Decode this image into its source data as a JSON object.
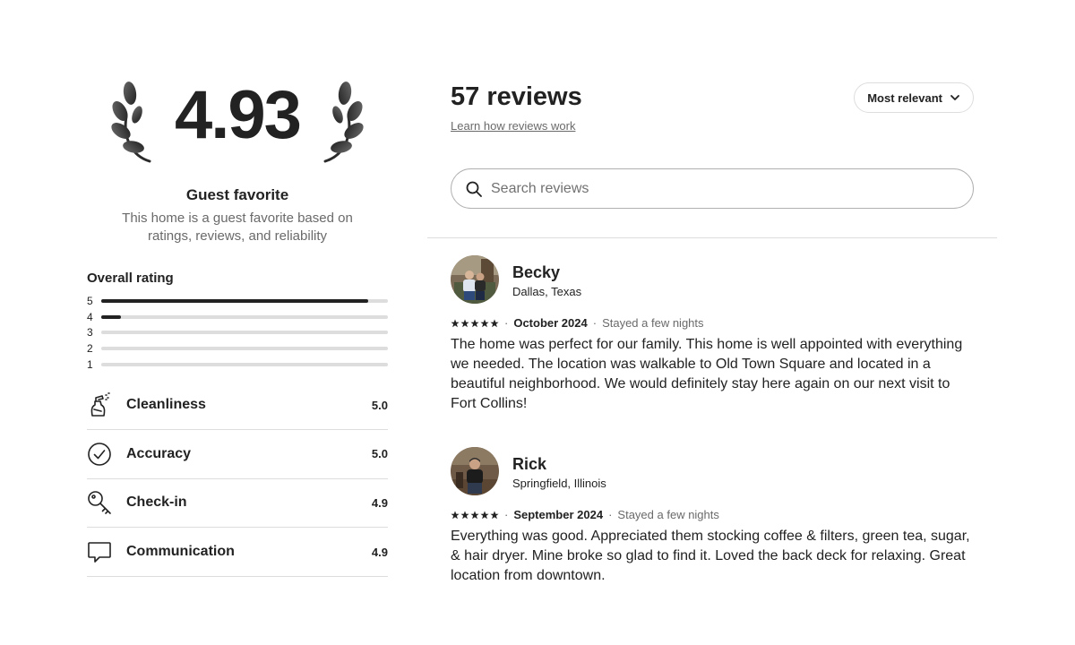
{
  "summary": {
    "rating": "4.93",
    "badge_title": "Guest favorite",
    "badge_desc": "This home is a guest favorite based on ratings, reviews, and reliability"
  },
  "overall": {
    "label": "Overall rating",
    "histogram": [
      {
        "star": "5",
        "fraction": 0.93
      },
      {
        "star": "4",
        "fraction": 0.07
      },
      {
        "star": "3",
        "fraction": 0
      },
      {
        "star": "2",
        "fraction": 0
      },
      {
        "star": "1",
        "fraction": 0
      }
    ]
  },
  "categories": [
    {
      "label": "Cleanliness",
      "value": "5.0",
      "icon": "spray-bottle-icon"
    },
    {
      "label": "Accuracy",
      "value": "5.0",
      "icon": "check-circle-icon"
    },
    {
      "label": "Check-in",
      "value": "4.9",
      "icon": "key-icon"
    },
    {
      "label": "Communication",
      "value": "4.9",
      "icon": "chat-bubble-icon"
    }
  ],
  "reviews_header": {
    "title": "57 reviews",
    "learn_link": "Learn how reviews work",
    "sort_label": "Most relevant",
    "search_placeholder": "Search reviews"
  },
  "reviews": [
    {
      "name": "Becky",
      "location": "Dallas, Texas",
      "stars": 5,
      "date": "October 2024",
      "stay": "Stayed a few nights",
      "text": "The home was perfect for our family. This home is well appointed with everything we needed. The location was walkable to Old Town Square and located in a beautiful neighborhood. We would definitely stay here again on our next visit to Fort Collins!"
    },
    {
      "name": "Rick",
      "location": "Springfield, Illinois",
      "stars": 5,
      "date": "September 2024",
      "stay": "Stayed a few nights",
      "text": "Everything was good. Appreciated them stocking coffee & filters, green tea, sugar, & hair dryer. Mine broke so glad to find it. Loved the back deck for relaxing. Great location from downtown."
    }
  ],
  "colors": {
    "text": "#222222",
    "muted": "#6a6a6a",
    "divider": "#dddddd",
    "search_border": "#b0b0b0"
  }
}
